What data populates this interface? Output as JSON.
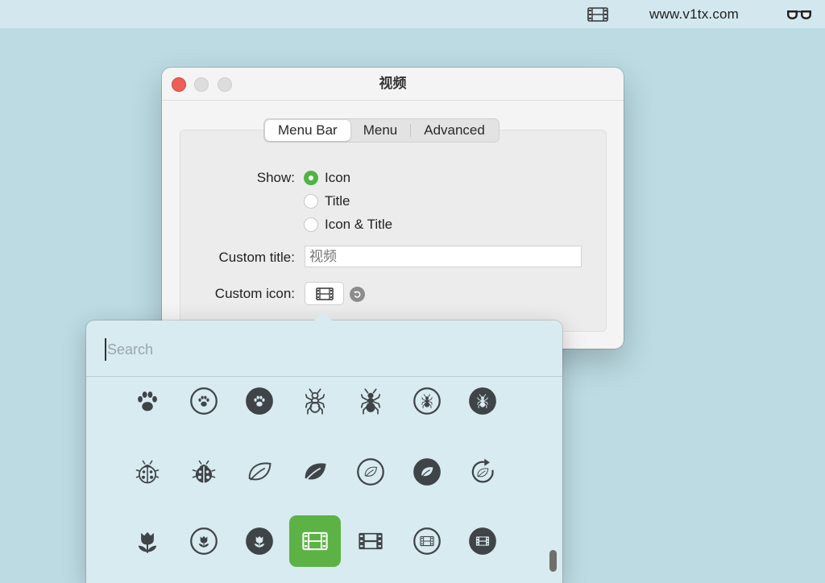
{
  "menubar": {
    "film_icon": "film-icon",
    "site_text": "www.v1tx.com",
    "glasses_icon": "glasses-icon"
  },
  "window": {
    "title": "视频",
    "tabs": [
      {
        "label": "Menu Bar",
        "active": true
      },
      {
        "label": "Menu",
        "active": false
      },
      {
        "label": "Advanced",
        "active": false
      }
    ],
    "show_label": "Show:",
    "show_options": [
      {
        "label": "Icon",
        "selected": true
      },
      {
        "label": "Title",
        "selected": false
      },
      {
        "label": "Icon & Title",
        "selected": false
      }
    ],
    "custom_title_label": "Custom title:",
    "custom_title_placeholder": "视频",
    "custom_icon_label": "Custom icon:",
    "custom_icon": "film-icon"
  },
  "popover": {
    "search_placeholder": "Search",
    "icons": [
      [
        "pawprint-icon",
        "pawprint-circle-icon",
        "pawprint-circle-fill-icon",
        "ant-icon",
        "ant-fill-icon",
        "ant-circle-icon",
        "ant-circle-fill-icon"
      ],
      [
        "ladybug-icon",
        "ladybug-fill-icon",
        "leaf-icon",
        "leaf-fill-icon",
        "leaf-circle-icon",
        "leaf-circle-fill-icon",
        "leaf-arrow-circlepath-icon"
      ],
      [
        "camera-macro-icon",
        "camera-macro-circle-icon",
        "camera-macro-circle-fill-icon",
        "film-icon",
        "film-fill-icon",
        "film-circle-icon",
        "film-circle-fill-icon"
      ]
    ],
    "selected_icon": "film-icon"
  },
  "colors": {
    "accent_green": "#5cb245",
    "close_red": "#ee5e57",
    "icon_gray": "#3f4448"
  }
}
